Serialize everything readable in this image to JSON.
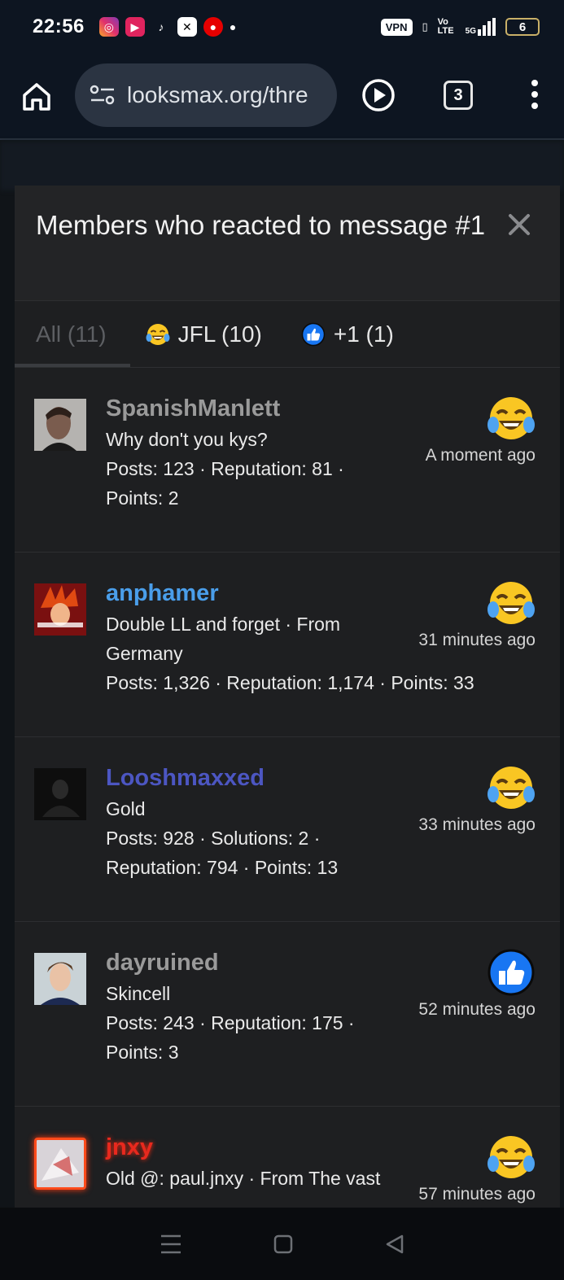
{
  "status": {
    "time": "22:56",
    "vpn": "VPN",
    "volte": "Vo LTE",
    "network": "5G",
    "battery": "6"
  },
  "browser": {
    "url": "looksmax.org/thre",
    "tab_count": "3"
  },
  "modal": {
    "title": "Members who reacted to message #1",
    "tabs": [
      {
        "label": "All (11)"
      },
      {
        "label": "JFL (10)"
      },
      {
        "label": "+1 (1)"
      }
    ],
    "members": [
      {
        "name": "SpanishManlett",
        "name_color": "#9a9a9a",
        "lines": [
          "Why don't you kys?",
          "Posts: 123 · Reputation: 81 ·",
          "Points: 2"
        ],
        "time": "A moment ago",
        "reaction": "jfl"
      },
      {
        "name": "anphamer",
        "name_color": "#4a9eea",
        "lines": [
          "Double LL and forget · From",
          "Germany",
          "Posts: 1,326 · Reputation: 1,174 · Points: 33"
        ],
        "time": "31 minutes ago",
        "reaction": "jfl"
      },
      {
        "name": "Looshmaxxed",
        "name_color": "#4c56c2",
        "lines": [
          "Gold",
          "Posts: 928 · Solutions: 2 ·",
          "Reputation: 794 · Points: 13"
        ],
        "time": "33 minutes ago",
        "reaction": "jfl"
      },
      {
        "name": "dayruined",
        "name_color": "#9a9a9a",
        "lines": [
          "Skincell",
          "Posts: 243 · Reputation: 175 ·",
          "Points: 3"
        ],
        "time": "52 minutes ago",
        "reaction": "plus1"
      },
      {
        "name": "jnxy",
        "name_color": "#e8291e",
        "lines": [
          "Old @: paul.jnxy · From The vast"
        ],
        "time": "57 minutes ago",
        "reaction": "jfl"
      }
    ]
  }
}
